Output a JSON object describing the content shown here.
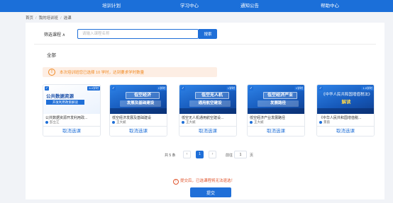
{
  "topnav": {
    "items": [
      "培训计划",
      "学习中心",
      "通知公告",
      "帮助中心"
    ]
  },
  "breadcrumb": [
    "首页",
    "我的培训班",
    "选课"
  ],
  "filter": {
    "label": "筛选课程",
    "chevron_icon": "chevron-up-icon",
    "search_placeholder": "请输入课程名称",
    "search_button": "搜索"
  },
  "category": "全部",
  "notice": {
    "icon": "info-icon",
    "text": "本次培训班您已选择 10 学时，达到要求学时数量"
  },
  "courses": [
    {
      "hours": "6.0学时",
      "cover_line1": "公共数据资源",
      "cover_line2": "开发利用政策解读",
      "title": "公共数据资源开发利用政...",
      "author": "彭立江",
      "action": "取消选课"
    },
    {
      "hours": "1学时",
      "cover_line1": "低空经济",
      "cover_line2": "发展及基础建设",
      "title": "低空经济发展及基础建设",
      "author": "王大斌",
      "action": "取消选课"
    },
    {
      "hours": "1学时",
      "cover_line1": "低空无人机",
      "cover_line2": "通用航空建设",
      "title": "低空无人机通用航空建设...",
      "author": "王大斌",
      "action": "取消选课"
    },
    {
      "hours": "1学时",
      "cover_line1": "低空经济产业",
      "cover_line2": "发展路径",
      "title": "低空经济产业发展路径",
      "author": "王大斌",
      "action": "取消选课"
    },
    {
      "hours": "1.0学时",
      "cover_line1": "《中华人民共和国增值税法》",
      "cover_line2": "解读",
      "title": "《中华人民共和国增值税...",
      "author": "景茵",
      "action": "取消选课"
    }
  ],
  "pagination": {
    "total_text": "共 5 条",
    "prev_icon": "chevron-left-icon",
    "current_page": "1",
    "next_icon": "chevron-right-icon",
    "goto_label": "前往",
    "goto_value": "1",
    "goto_unit": "页"
  },
  "submit_notice": {
    "icon": "warning-icon",
    "text": "提交后，已选课程将无法退选！"
  },
  "submit_button": "提交"
}
